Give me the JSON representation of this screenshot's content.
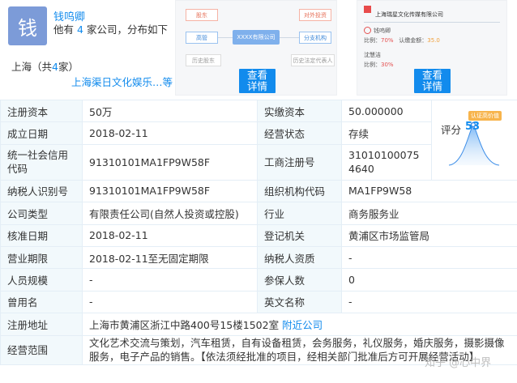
{
  "person": {
    "avatar_char": "钱",
    "name": "钱呜卿",
    "count_prefix": "他有",
    "count_num": "4",
    "count_suffix": "家公司，分布如下",
    "region_prefix": "上海（共",
    "region_num": "4",
    "region_suffix": "家）",
    "company": "上海渠日文化娱乐…等"
  },
  "diagram1": {
    "nodes": [
      "股东",
      "对外投资",
      "高管",
      "XXXX有限公司",
      "分支机构",
      "历史股东",
      "历史法定代表人"
    ],
    "button": "查看\n详情"
  },
  "diagram2": {
    "title": "上海瑞星文化传媒有限公司",
    "row1_name": "钱呜卿",
    "row1_ratio_label": "比例：",
    "row1_ratio": "70%",
    "row1_amount_label": "认缴金额：",
    "row1_amount": "35.0",
    "row2_name": "沈慧洁",
    "row2_ratio_label": "比例：",
    "row2_ratio": "30%",
    "button": "查看\n详情"
  },
  "score": {
    "label": "评分",
    "value": "53",
    "badge": "认证高价值"
  },
  "table": {
    "reg_capital_label": "注册资本",
    "reg_capital": "50万",
    "paid_capital_label": "实缴资本",
    "paid_capital": "50.000000",
    "est_date_label": "成立日期",
    "est_date": "2018-02-11",
    "status_label": "经营状态",
    "status": "存续",
    "credit_code_label": "统一社会信用代码",
    "credit_code": "91310101MA1FP9W58F",
    "reg_no_label": "工商注册号",
    "reg_no": "310101000754640",
    "taxpayer_id_label": "纳税人识别号",
    "taxpayer_id": "91310101MA1FP9W58F",
    "org_code_label": "组织机构代码",
    "org_code": "MA1FP9W58",
    "company_type_label": "公司类型",
    "company_type": "有限责任公司(自然人投资或控股)",
    "industry_label": "行业",
    "industry": "商务服务业",
    "approval_date_label": "核准日期",
    "approval_date": "2018-02-11",
    "authority_label": "登记机关",
    "authority": "黄浦区市场监管局",
    "term_label": "营业期限",
    "term": "2018-02-11至无固定期限",
    "taxpayer_qual_label": "纳税人资质",
    "taxpayer_qual": "-",
    "staff_size_label": "人员规模",
    "staff_size": "-",
    "insured_label": "参保人数",
    "insured": "0",
    "former_name_label": "曾用名",
    "former_name": "-",
    "english_name_label": "英文名称",
    "english_name": "-",
    "address_label": "注册地址",
    "address": "上海市黄浦区浙江中路400号15楼1502室",
    "nearby": "附近公司",
    "scope_label": "经营范围",
    "scope": "文化艺术交流与策划，汽车租赁，自有设备租赁，会务服务，礼仪服务，婚庆服务，摄影摄像服务，电子产品的销售。【依法须经批准的项目，经相关部门批准后方可开展经营活动】"
  },
  "watermark": "知乎 @心中界"
}
